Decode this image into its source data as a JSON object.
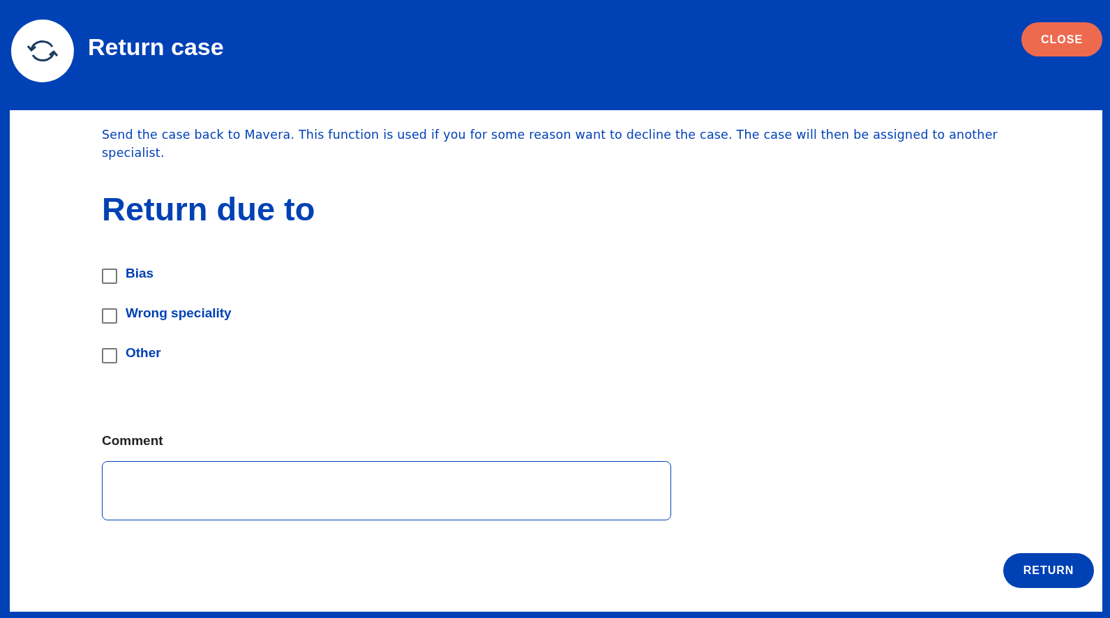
{
  "header": {
    "title": "Return case",
    "close_button": "CLOSE"
  },
  "description": "Send the case back to Mavera. This function is used if you for some reason want to decline the case. The case will then be assigned to another specialist.",
  "section_title": "Return due to",
  "reasons": [
    {
      "label": "Bias",
      "checked": false
    },
    {
      "label": "Wrong speciality",
      "checked": false
    },
    {
      "label": "Other",
      "checked": false
    }
  ],
  "comment": {
    "label": "Comment"
  },
  "return_button": "RETURN"
}
